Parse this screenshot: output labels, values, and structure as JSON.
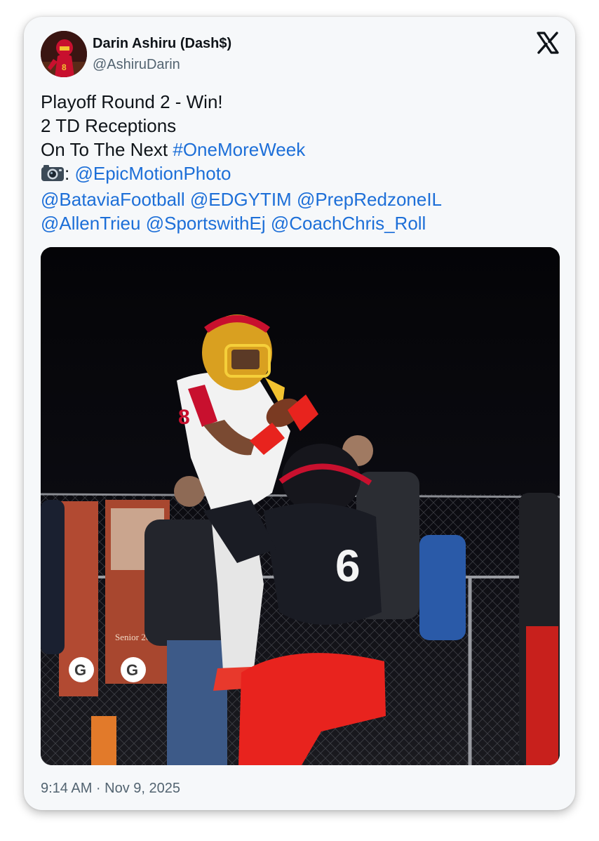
{
  "author": {
    "name": "Darin Ashiru (Dash$)",
    "handle": "@AshiruDarin"
  },
  "brand": {
    "logo_icon": "x-logo-icon",
    "logo_color": "#0f1419"
  },
  "tweet": {
    "line1": "Playoff Round 2 - Win!",
    "line2": "2 TD Receptions",
    "line3_text": "On To The Next ",
    "hashtag": "#OneMoreWeek",
    "camera_icon": "camera-icon",
    "camera_sep": ": ",
    "photo_credit": "@EpicMotionPhoto",
    "mentions_row1": [
      "@BataviaFootball",
      "@EDGYTIM",
      "@PrepRedzoneIL"
    ],
    "mentions_row2": [
      "@AllenTrieu",
      "@SportswithEj",
      "@CoachChris_Roll"
    ]
  },
  "media": {
    "description_icon": "football-catch-photo",
    "jersey_numbers": [
      "8",
      "6"
    ],
    "banner_texts": [
      "Senior 2026",
      "Senior 2026"
    ]
  },
  "timestamp": "9:14 AM · Nov 9, 2025",
  "colors": {
    "link": "#1d6fd8",
    "text": "#0f1419",
    "muted": "#536471",
    "card_bg": "#f6f8fa"
  }
}
